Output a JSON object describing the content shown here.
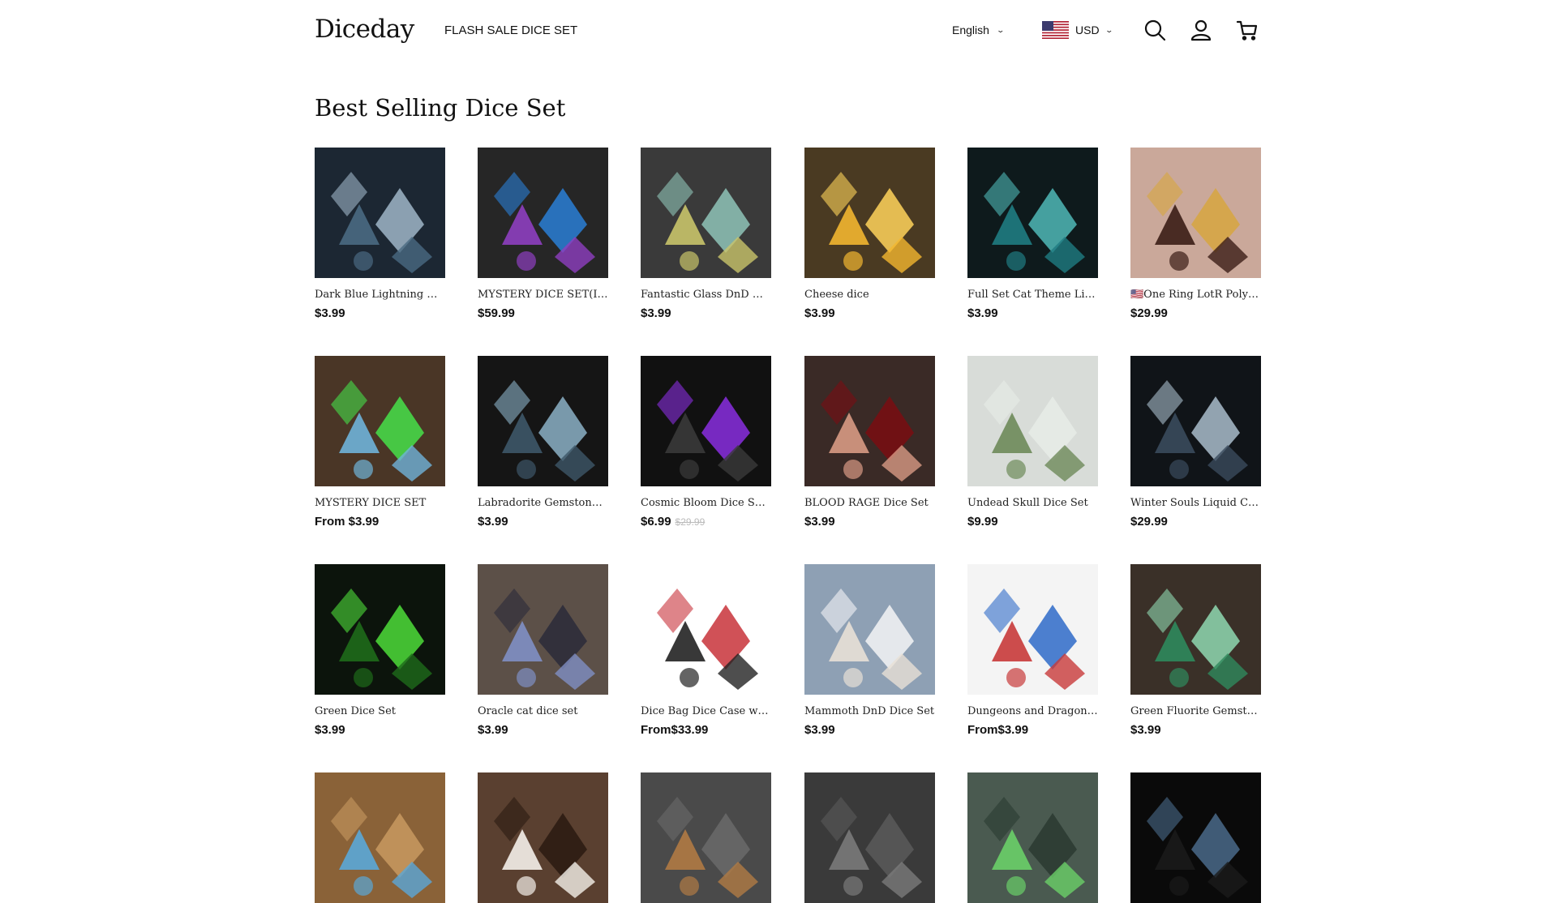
{
  "header": {
    "logo": "Diceday",
    "nav_link": "FLASH SALE DICE SET",
    "language": "English",
    "currency": "USD",
    "icons": [
      "search-icon",
      "account-icon",
      "cart-icon"
    ]
  },
  "section": {
    "title": "Best Selling Dice Set"
  },
  "products": [
    {
      "name": "Dark Blue Lightning Gl...",
      "price": "$3.99",
      "compare": "",
      "palette": [
        "#1c2733",
        "#4a6a82",
        "#9fb6c8"
      ]
    },
    {
      "name": "MYSTERY DICE SET(In...",
      "price": "$59.99",
      "compare": "",
      "palette": [
        "#262626",
        "#8e3fc0",
        "#2a7fd6"
      ]
    },
    {
      "name": "Fantastic Glass DnD Di...",
      "price": "$3.99",
      "compare": "",
      "palette": [
        "#3a3a3a",
        "#c9c46a",
        "#8fc4b8"
      ]
    },
    {
      "name": "Cheese dice",
      "price": "$3.99",
      "compare": "",
      "palette": [
        "#4a3a22",
        "#f2b630",
        "#ffd35a"
      ]
    },
    {
      "name": "Full Set Cat Theme Lig...",
      "price": "$3.99",
      "compare": "",
      "palette": [
        "#0e1a1c",
        "#1f7c82",
        "#4fb8b6"
      ]
    },
    {
      "name": "🇺🇸One Ring LotR Polyhe...",
      "price": "$29.99",
      "compare": "",
      "palette": [
        "#caa89a",
        "#3b1d16",
        "#d7a640"
      ]
    },
    {
      "name": "MYSTERY DICE SET",
      "price": "From $3.99",
      "compare": "",
      "palette": [
        "#4a3626",
        "#6fb3d9",
        "#46e04a"
      ]
    },
    {
      "name": "Labradorite Gemstone ...",
      "price": "$3.99",
      "compare": "",
      "palette": [
        "#151515",
        "#3d5668",
        "#8bb0c6"
      ]
    },
    {
      "name": "Cosmic Bloom Dice Set ...",
      "price": "$6.99",
      "compare": "$29.99",
      "palette": [
        "#111111",
        "#3a3a3a",
        "#8a2ee0"
      ]
    },
    {
      "name": "BLOOD RAGE Dice Set",
      "price": "$3.99",
      "compare": "",
      "palette": [
        "#3a2a26",
        "#d89a84",
        "#7a0d12"
      ]
    },
    {
      "name": "Undead Skull Dice Set",
      "price": "$9.99",
      "compare": "",
      "palette": [
        "#d8dcd8",
        "#6e8a5a",
        "#e8ece8"
      ]
    },
    {
      "name": "Winter Souls Liquid Co...",
      "price": "$29.99",
      "compare": "",
      "palette": [
        "#101418",
        "#3a4a5c",
        "#a9bccb"
      ]
    },
    {
      "name": "Green Dice Set",
      "price": "$3.99",
      "compare": "",
      "palette": [
        "#0c140c",
        "#1e6a1a",
        "#4edc3a"
      ]
    },
    {
      "name": "Oracle cat dice set",
      "price": "$3.99",
      "compare": "",
      "palette": [
        "#5c5048",
        "#7f8fc4",
        "#2a2a3a"
      ]
    },
    {
      "name": "Dice Bag Dice Case wit...",
      "price": "From$33.99",
      "compare": "",
      "palette": [
        "#ffffff",
        "#222222",
        "#c8323a"
      ]
    },
    {
      "name": "Mammoth DnD Dice Set",
      "price": "$3.99",
      "compare": "",
      "palette": [
        "#8ea0b4",
        "#e8e0d6",
        "#f4f4f6"
      ]
    },
    {
      "name": "Dungeons and Dragons...",
      "price": "From$3.99",
      "compare": "",
      "palette": [
        "#f4f4f4",
        "#c83a3a",
        "#2e6ac8"
      ]
    },
    {
      "name": "Green Fluorite Gemsto...",
      "price": "$3.99",
      "compare": "",
      "palette": [
        "#3a3028",
        "#2f8a5c",
        "#8fd8b0"
      ]
    },
    {
      "name": "",
      "price": "",
      "compare": "",
      "palette": [
        "#8a6238",
        "#5aa8d8",
        "#c89a60"
      ]
    },
    {
      "name": "",
      "price": "",
      "compare": "",
      "palette": [
        "#5a4030",
        "#f4f0ea",
        "#2a1a10"
      ]
    },
    {
      "name": "",
      "price": "",
      "compare": "",
      "palette": [
        "#4a4a4a",
        "#b07a44",
        "#6a6a6a"
      ]
    },
    {
      "name": "",
      "price": "",
      "compare": "",
      "palette": [
        "#3a3a3a",
        "#7a7a7a",
        "#5a5a5a"
      ]
    },
    {
      "name": "",
      "price": "",
      "compare": "",
      "palette": [
        "#4a5a50",
        "#6acf68",
        "#2a3a30"
      ]
    },
    {
      "name": "",
      "price": "",
      "compare": "",
      "palette": [
        "#0a0a0a",
        "#1a1a1a",
        "#4a6a8a"
      ]
    }
  ]
}
